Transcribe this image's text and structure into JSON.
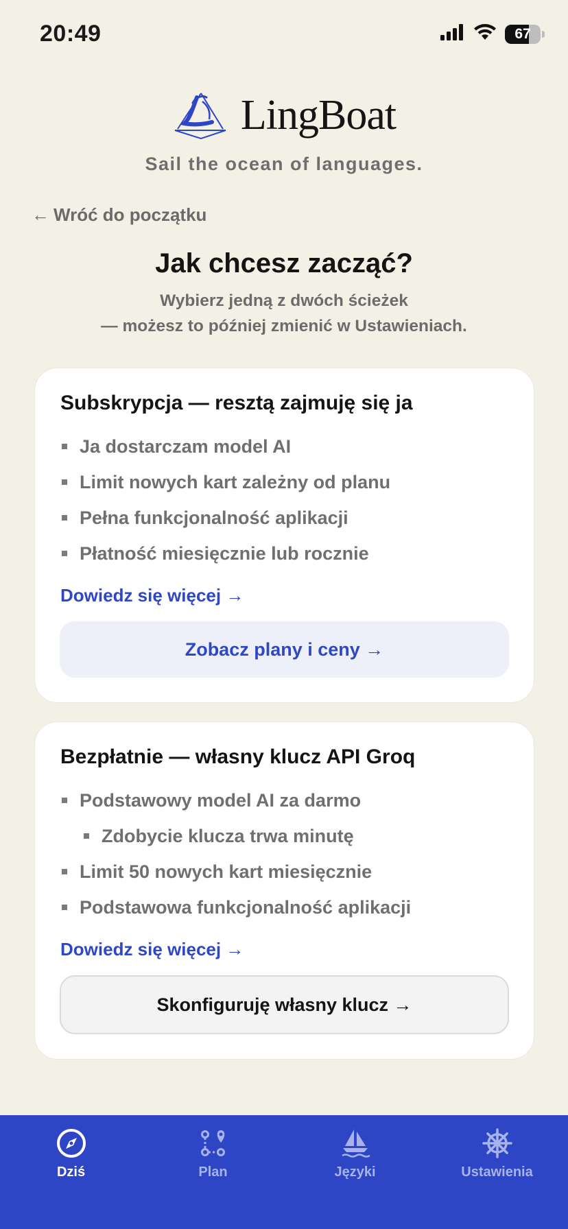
{
  "status_bar": {
    "time": "20:49",
    "battery_level": "67",
    "battery_fraction": 0.67,
    "icons": [
      "signal-icon",
      "wifi-icon",
      "battery-icon"
    ]
  },
  "brand": {
    "name": "LingBoat",
    "tagline": "Sail the ocean of languages.",
    "accent_color": "#2e46c6"
  },
  "back_link": {
    "arrow": "←",
    "label": "Wróć do początku"
  },
  "heading": "Jak chcesz zacząć?",
  "subheading": {
    "line1": "Wybierz jedną z dwóch ścieżek",
    "line2": "— możesz to później zmienić w Ustawieniach."
  },
  "cards": [
    {
      "title": "Subskrypcja — resztą zajmuję się ja",
      "bullets": [
        "Ja dostarczam model AI",
        "Limit nowych kart zależny od planu",
        "Pełna funkcjonalność aplikacji",
        "Płatność miesięcznie lub rocznie"
      ],
      "learn_more": "Dowiedz się więcej →",
      "button": "Zobacz plany i ceny →"
    },
    {
      "title": "Bezpłatnie — własny klucz API Groq",
      "bullets": [
        "Podstawowy model AI za darmo",
        "Zdobycie klucza trwa minutę",
        "Limit 50 nowych kart miesięcznie",
        "Podstawowa funkcjonalność aplikacji"
      ],
      "learn_more": "Dowiedz się więcej →",
      "button": "Skonfiguruję własny klucz →"
    }
  ],
  "tab_bar": {
    "tabs": [
      {
        "label": "Dziś",
        "icon": "compass-icon",
        "active": true
      },
      {
        "label": "Plan",
        "icon": "route-icon",
        "active": false
      },
      {
        "label": "Języki",
        "icon": "sailboat-icon",
        "active": false
      },
      {
        "label": "Ustawienia",
        "icon": "helm-icon",
        "active": false
      }
    ]
  }
}
